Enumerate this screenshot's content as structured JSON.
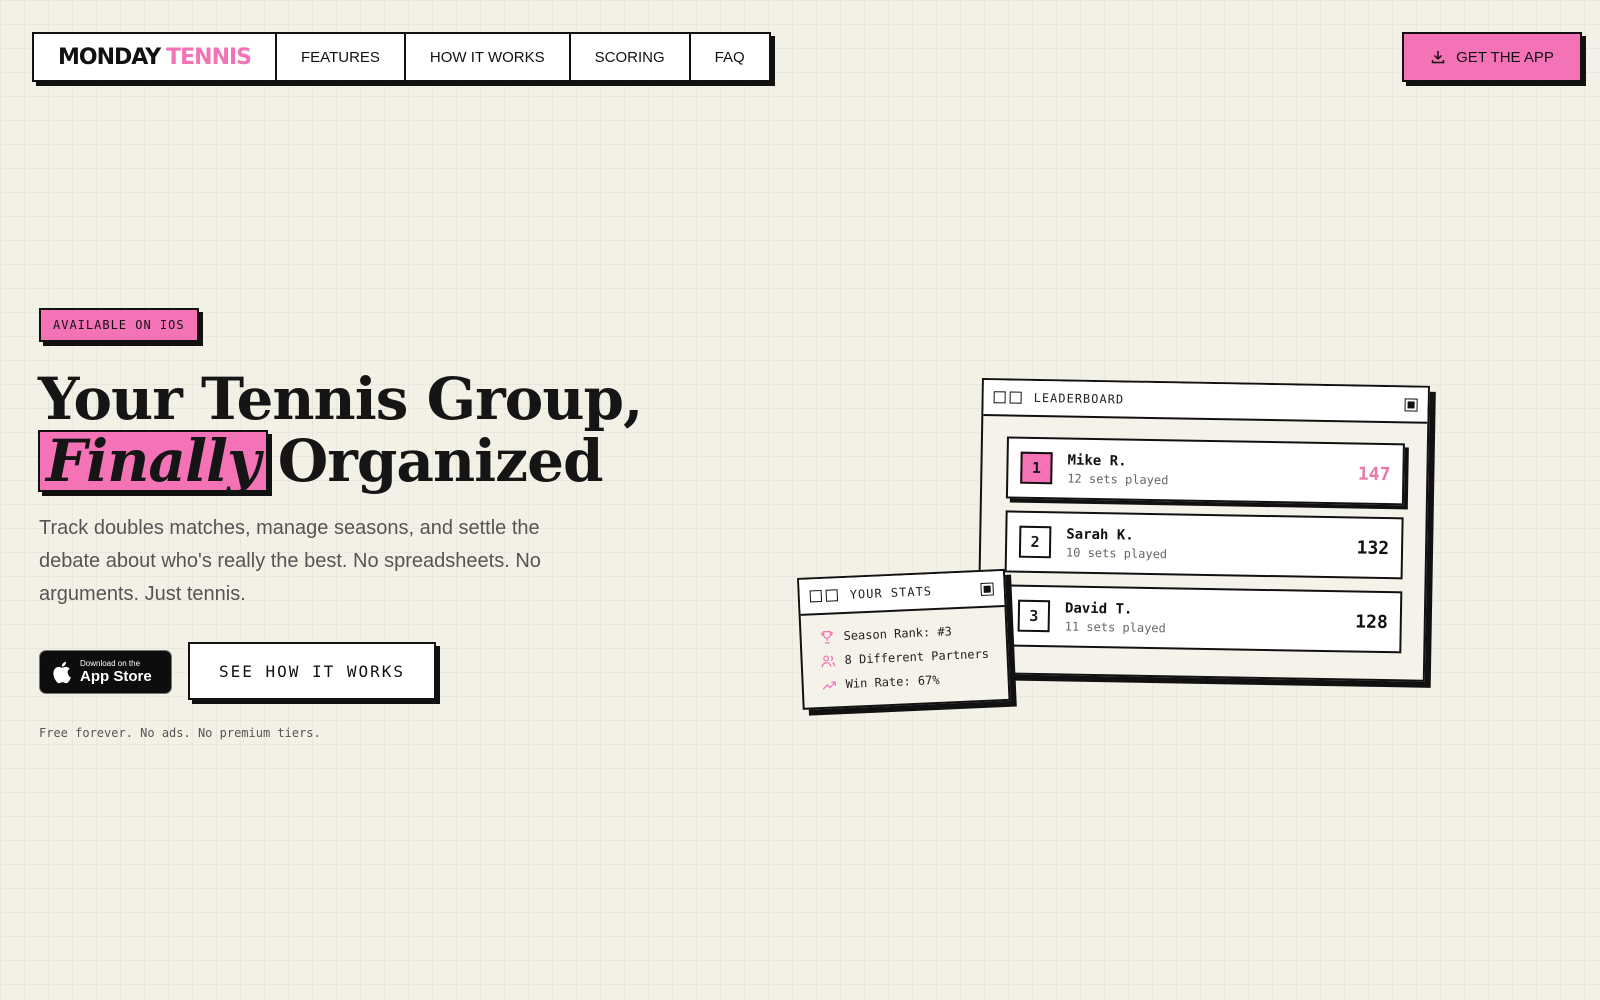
{
  "brand": {
    "word1": "MONDAY",
    "word2": "TENNIS"
  },
  "nav": {
    "items": [
      "FEATURES",
      "HOW IT WORKS",
      "SCORING",
      "FAQ"
    ]
  },
  "cta": {
    "label": "GET THE APP"
  },
  "hero": {
    "badge": "AVAILABLE ON IOS",
    "headline_line1": "Your Tennis Group,",
    "headline_highlight": "Finally",
    "headline_rest": "Organized",
    "subtext": "Track doubles matches, manage seasons, and settle the debate about who's really the best. No spreadsheets. No arguments. Just tennis.",
    "appstore_small": "Download on the",
    "appstore_big": "App Store",
    "secondary_button": "SEE HOW IT WORKS",
    "fineprint": "Free forever. No ads. No premium tiers."
  },
  "leaderboard": {
    "title": "LEADERBOARD",
    "rows": [
      {
        "rank": "1",
        "name": "Mike R.",
        "sets": "12 sets played",
        "score": "147"
      },
      {
        "rank": "2",
        "name": "Sarah K.",
        "sets": "10 sets played",
        "score": "132"
      },
      {
        "rank": "3",
        "name": "David T.",
        "sets": "11 sets played",
        "score": "128"
      }
    ]
  },
  "stats": {
    "title": "YOUR STATS",
    "items": [
      {
        "icon": "trophy-icon",
        "text": "Season Rank: #3"
      },
      {
        "icon": "users-icon",
        "text": "8 Different Partners"
      },
      {
        "icon": "trending-up-icon",
        "text": "Win Rate: 67%"
      }
    ]
  },
  "colors": {
    "accent": "#f472b6",
    "background": "#f3f0e6",
    "ink": "#111111"
  }
}
